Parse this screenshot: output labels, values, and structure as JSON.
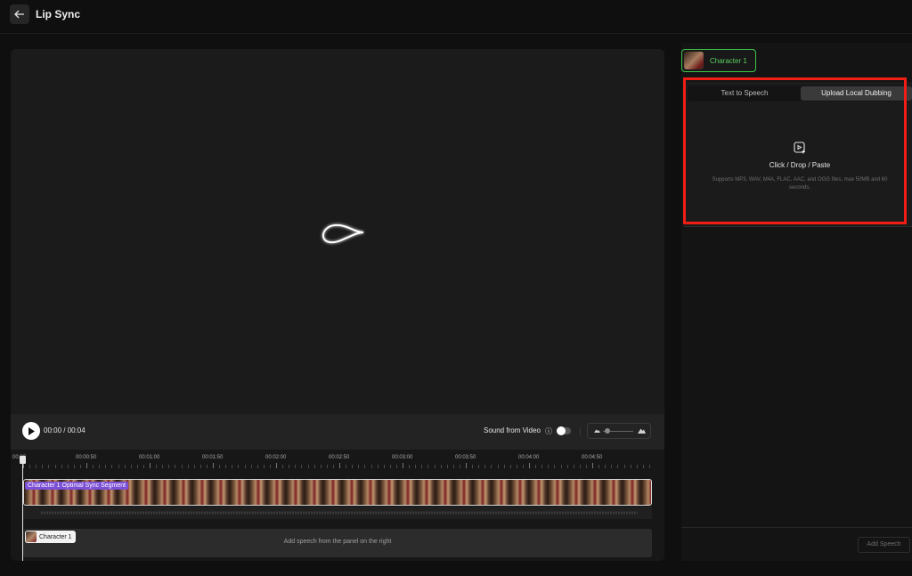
{
  "header": {
    "title": "Lip Sync",
    "back_icon": "arrow-left-icon"
  },
  "player": {
    "time": "00:00 / 00:04",
    "sound_label": "Sound from Video",
    "sound_enabled": false,
    "loading_icon": "loading-spinner-icon"
  },
  "timeline": {
    "ticks": [
      "00:00",
      "00:00:50",
      "00:01:00",
      "00:01:50",
      "00:02:00",
      "00:02:50",
      "00:03:00",
      "00:03:50",
      "00:04:00",
      "00:04:50"
    ],
    "segment_label": "Character 1 Optimal Sync Segment",
    "character_chip": "Character 1",
    "speech_hint": "Add speech from the panel on the right"
  },
  "right_panel": {
    "character_tab": "Character 1",
    "tabs": [
      "Text to Speech",
      "Upload Local Dubbing"
    ],
    "active_tab": "Upload Local Dubbing",
    "upload_title": "Click / Drop / Paste",
    "upload_hint_line1": "Supports MP3, WAV, M4A, FLAC, AAC, and OGG files, max 50MB and 60",
    "upload_hint_line2": "seconds.",
    "add_speech_label": "Add Speech"
  },
  "colors": {
    "accent_green": "#3ec64a",
    "segment_purple": "#7b4fd6",
    "highlight_red": "#f01e14"
  }
}
